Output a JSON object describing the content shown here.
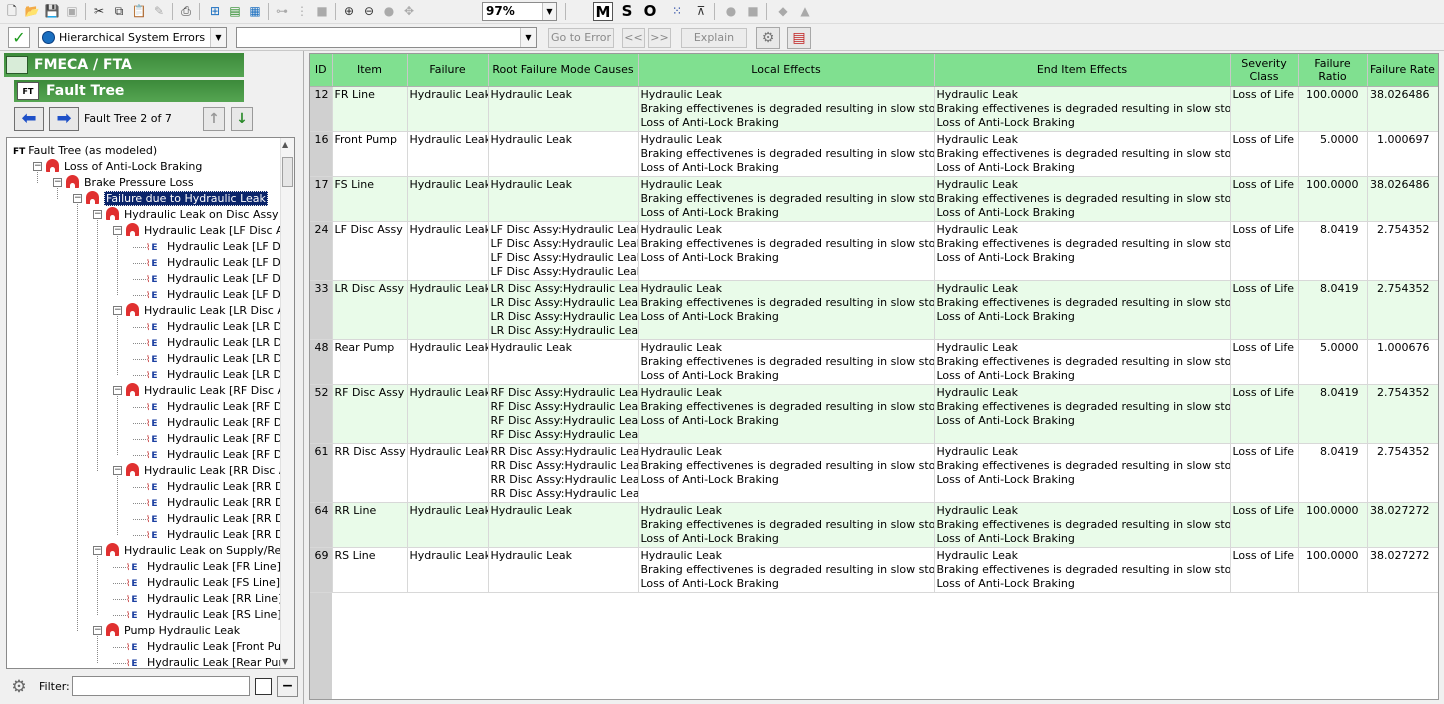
{
  "toolbar": {
    "zoom_value": "97%",
    "mode_m": "M",
    "mode_s": "S",
    "mode_o": "O"
  },
  "toolbar2": {
    "view_select": "Hierarchical System Errors",
    "error_select": "",
    "goto_error": "Go to Error",
    "prev": "<<",
    "next": ">>",
    "explain": "Explain"
  },
  "left": {
    "fmeca_title": "FMECA / FTA",
    "fault_tree_title": "Fault Tree",
    "fault_tree_count": "Fault Tree 2 of 7",
    "filter_label": "Filter:",
    "filter_value": "",
    "tree": [
      {
        "label": "Fault Tree (as modeled)",
        "level": 0,
        "type": "root",
        "expander": ""
      },
      {
        "label": "Loss of Anti-Lock Braking",
        "level": 1,
        "type": "gate",
        "expander": "−"
      },
      {
        "label": "Brake Pressure Loss",
        "level": 2,
        "type": "gate",
        "expander": "−"
      },
      {
        "label": "Failure due to Hydraulic Leak",
        "level": 3,
        "type": "gate",
        "expander": "−",
        "selected": true
      },
      {
        "label": "Hydraulic Leak on Disc Assy",
        "level": 4,
        "type": "gate",
        "expander": "−"
      },
      {
        "label": "Hydraulic Leak [LF Disc Assy]",
        "level": 5,
        "type": "gate",
        "expander": "−"
      },
      {
        "label": "Hydraulic Leak [LF Disc As",
        "level": 6,
        "type": "event",
        "expander": ""
      },
      {
        "label": "Hydraulic Leak [LF Disc As",
        "level": 6,
        "type": "event",
        "expander": ""
      },
      {
        "label": "Hydraulic Leak [LF Disc As",
        "level": 6,
        "type": "event",
        "expander": ""
      },
      {
        "label": "Hydraulic Leak [LF Disc As",
        "level": 6,
        "type": "event",
        "expander": ""
      },
      {
        "label": "Hydraulic Leak [LR Disc Assy]",
        "level": 5,
        "type": "gate",
        "expander": "−"
      },
      {
        "label": "Hydraulic Leak [LR Disc As",
        "level": 6,
        "type": "event",
        "expander": ""
      },
      {
        "label": "Hydraulic Leak [LR Disc As",
        "level": 6,
        "type": "event",
        "expander": ""
      },
      {
        "label": "Hydraulic Leak [LR Disc As",
        "level": 6,
        "type": "event",
        "expander": ""
      },
      {
        "label": "Hydraulic Leak [LR Disc As",
        "level": 6,
        "type": "event",
        "expander": ""
      },
      {
        "label": "Hydraulic Leak [RF Disc Assy]",
        "level": 5,
        "type": "gate",
        "expander": "−"
      },
      {
        "label": "Hydraulic Leak [RF Disc As",
        "level": 6,
        "type": "event",
        "expander": ""
      },
      {
        "label": "Hydraulic Leak [RF Disc As",
        "level": 6,
        "type": "event",
        "expander": ""
      },
      {
        "label": "Hydraulic Leak [RF Disc As",
        "level": 6,
        "type": "event",
        "expander": ""
      },
      {
        "label": "Hydraulic Leak [RF Disc As",
        "level": 6,
        "type": "event",
        "expander": ""
      },
      {
        "label": "Hydraulic Leak [RR Disc Assy]",
        "level": 5,
        "type": "gate",
        "expander": "−"
      },
      {
        "label": "Hydraulic Leak [RR Disc A",
        "level": 6,
        "type": "event",
        "expander": ""
      },
      {
        "label": "Hydraulic Leak [RR Disc A",
        "level": 6,
        "type": "event",
        "expander": ""
      },
      {
        "label": "Hydraulic Leak [RR Disc A",
        "level": 6,
        "type": "event",
        "expander": ""
      },
      {
        "label": "Hydraulic Leak [RR Disc A",
        "level": 6,
        "type": "event",
        "expander": ""
      },
      {
        "label": "Hydraulic Leak on Supply/Return L",
        "level": 4,
        "type": "gate",
        "expander": "−"
      },
      {
        "label": "Hydraulic Leak [FR Line]",
        "level": 5,
        "type": "event",
        "expander": ""
      },
      {
        "label": "Hydraulic Leak [FS Line]",
        "level": 5,
        "type": "event",
        "expander": ""
      },
      {
        "label": "Hydraulic Leak [RR Line]",
        "level": 5,
        "type": "event",
        "expander": ""
      },
      {
        "label": "Hydraulic Leak [RS Line]",
        "level": 5,
        "type": "event",
        "expander": ""
      },
      {
        "label": "Pump Hydraulic Leak",
        "level": 4,
        "type": "gate",
        "expander": "−"
      },
      {
        "label": "Hydraulic Leak [Front Pump]",
        "level": 5,
        "type": "event",
        "expander": ""
      },
      {
        "label": "Hydraulic Leak [Rear Pump]",
        "level": 5,
        "type": "event",
        "expander": ""
      }
    ]
  },
  "table": {
    "headers": [
      "ID",
      "Item",
      "Failure",
      "Root Failure Mode Causes",
      "Local Effects",
      "End Item Effects",
      "Severity Class",
      "Failure Ratio",
      "Failure Rate"
    ],
    "rows": [
      {
        "id": "12",
        "item": "FR Line",
        "failure": "Hydraulic Leak",
        "causes": [
          "Hydraulic Leak"
        ],
        "local": [
          "Hydraulic Leak",
          "Braking effectivenes is degraded resulting in slow stopping",
          "Loss of Anti-Lock Braking"
        ],
        "end": [
          "Hydraulic Leak",
          "Braking effectivenes is degraded resulting in slow stopping",
          "Loss of Anti-Lock Braking"
        ],
        "severity": "Loss of Life",
        "ratio": "100.0000",
        "rate": "38.026486"
      },
      {
        "id": "16",
        "item": "Front Pump",
        "failure": "Hydraulic Leak",
        "causes": [
          "Hydraulic Leak"
        ],
        "local": [
          "Hydraulic Leak",
          "Braking effectivenes is degraded resulting in slow stopping",
          "Loss of Anti-Lock Braking"
        ],
        "end": [
          "Hydraulic Leak",
          "Braking effectivenes is degraded resulting in slow stopping",
          "Loss of Anti-Lock Braking"
        ],
        "severity": "Loss of Life",
        "ratio": "5.0000",
        "rate": "1.000697"
      },
      {
        "id": "17",
        "item": "FS Line",
        "failure": "Hydraulic Leak",
        "causes": [
          "Hydraulic Leak"
        ],
        "local": [
          "Hydraulic Leak",
          "Braking effectivenes is degraded resulting in slow stopping",
          "Loss of Anti-Lock Braking"
        ],
        "end": [
          "Hydraulic Leak",
          "Braking effectivenes is degraded resulting in slow stopping",
          "Loss of Anti-Lock Braking"
        ],
        "severity": "Loss of Life",
        "ratio": "100.0000",
        "rate": "38.026486"
      },
      {
        "id": "24",
        "item": "LF Disc Assy",
        "failure": "Hydraulic Leak",
        "causes": [
          "LF Disc Assy:Hydraulic Leak",
          "LF Disc Assy:Hydraulic Leak",
          "LF Disc Assy:Hydraulic Leak",
          "LF Disc Assy:Hydraulic Leak"
        ],
        "local": [
          "Hydraulic Leak",
          "Braking effectivenes is degraded resulting in slow stopping",
          "Loss of Anti-Lock Braking"
        ],
        "end": [
          "Hydraulic Leak",
          "Braking effectivenes is degraded resulting in slow stopping",
          "Loss of Anti-Lock Braking"
        ],
        "severity": "Loss of Life",
        "ratio": "8.0419",
        "rate": "2.754352"
      },
      {
        "id": "33",
        "item": "LR Disc Assy",
        "failure": "Hydraulic Leak",
        "causes": [
          "LR Disc Assy:Hydraulic Leak",
          "LR Disc Assy:Hydraulic Leak",
          "LR Disc Assy:Hydraulic Leak",
          "LR Disc Assy:Hydraulic Leak"
        ],
        "local": [
          "Hydraulic Leak",
          "Braking effectivenes is degraded resulting in slow stopping",
          "Loss of Anti-Lock Braking"
        ],
        "end": [
          "Hydraulic Leak",
          "Braking effectivenes is degraded resulting in slow stopping",
          "Loss of Anti-Lock Braking"
        ],
        "severity": "Loss of Life",
        "ratio": "8.0419",
        "rate": "2.754352"
      },
      {
        "id": "48",
        "item": "Rear Pump",
        "failure": "Hydraulic Leak",
        "causes": [
          "Hydraulic Leak"
        ],
        "local": [
          "Hydraulic Leak",
          "Braking effectivenes is degraded resulting in slow stopping",
          "Loss of Anti-Lock Braking"
        ],
        "end": [
          "Hydraulic Leak",
          "Braking effectivenes is degraded resulting in slow stopping",
          "Loss of Anti-Lock Braking"
        ],
        "severity": "Loss of Life",
        "ratio": "5.0000",
        "rate": "1.000676"
      },
      {
        "id": "52",
        "item": "RF Disc Assy",
        "failure": "Hydraulic Leak",
        "causes": [
          "RF Disc Assy:Hydraulic Leak",
          "RF Disc Assy:Hydraulic Leak",
          "RF Disc Assy:Hydraulic Leak",
          "RF Disc Assy:Hydraulic Leak"
        ],
        "local": [
          "Hydraulic Leak",
          "Braking effectivenes is degraded resulting in slow stopping",
          "Loss of Anti-Lock Braking"
        ],
        "end": [
          "Hydraulic Leak",
          "Braking effectivenes is degraded resulting in slow stopping",
          "Loss of Anti-Lock Braking"
        ],
        "severity": "Loss of Life",
        "ratio": "8.0419",
        "rate": "2.754352"
      },
      {
        "id": "61",
        "item": "RR Disc Assy",
        "failure": "Hydraulic Leak",
        "causes": [
          "RR Disc Assy:Hydraulic Leak",
          "RR Disc Assy:Hydraulic Leak",
          "RR Disc Assy:Hydraulic Leak",
          "RR Disc Assy:Hydraulic Leak"
        ],
        "local": [
          "Hydraulic Leak",
          "Braking effectivenes is degraded resulting in slow stopping",
          "Loss of Anti-Lock Braking"
        ],
        "end": [
          "Hydraulic Leak",
          "Braking effectivenes is degraded resulting in slow stopping",
          "Loss of Anti-Lock Braking"
        ],
        "severity": "Loss of Life",
        "ratio": "8.0419",
        "rate": "2.754352"
      },
      {
        "id": "64",
        "item": "RR Line",
        "failure": "Hydraulic Leak",
        "causes": [
          "Hydraulic Leak"
        ],
        "local": [
          "Hydraulic Leak",
          "Braking effectivenes is degraded resulting in slow stopping",
          "Loss of Anti-Lock Braking"
        ],
        "end": [
          "Hydraulic Leak",
          "Braking effectivenes is degraded resulting in slow stopping",
          "Loss of Anti-Lock Braking"
        ],
        "severity": "Loss of Life",
        "ratio": "100.0000",
        "rate": "38.027272"
      },
      {
        "id": "69",
        "item": "RS Line",
        "failure": "Hydraulic Leak",
        "causes": [
          "Hydraulic Leak"
        ],
        "local": [
          "Hydraulic Leak",
          "Braking effectivenes is degraded resulting in slow stopping",
          "Loss of Anti-Lock Braking"
        ],
        "end": [
          "Hydraulic Leak",
          "Braking effectivenes is degraded resulting in slow stopping",
          "Loss of Anti-Lock Braking"
        ],
        "severity": "Loss of Life",
        "ratio": "100.0000",
        "rate": "38.027272"
      }
    ]
  }
}
